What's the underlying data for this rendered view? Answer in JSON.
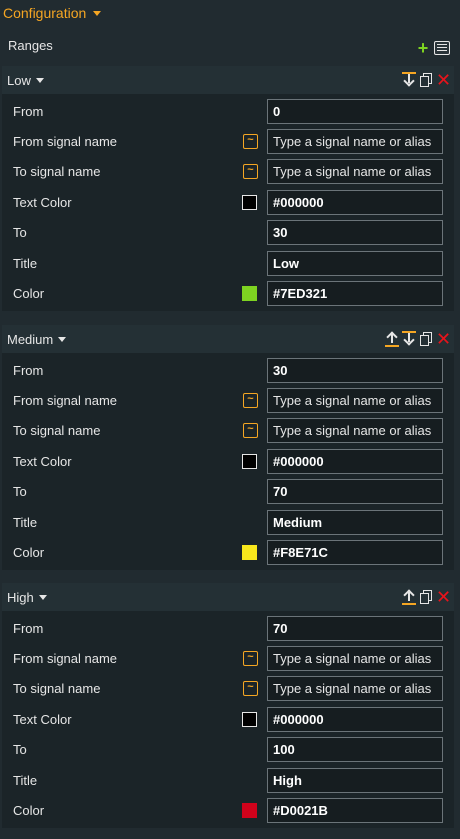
{
  "configuration": {
    "title": "Configuration"
  },
  "ranges": {
    "label": "Ranges",
    "add_icon": "plus-icon",
    "list_icon": "list-icon"
  },
  "labels": {
    "from": "From",
    "from_signal": "From signal name",
    "to_signal": "To signal name",
    "text_color": "Text Color",
    "to": "To",
    "title": "Title",
    "color": "Color"
  },
  "placeholder": "Type a signal name or alias",
  "range_items": [
    {
      "name": "Low",
      "from": "0",
      "text_color": "#000000",
      "to": "30",
      "title": "Low",
      "color": "#7ED321",
      "swatch": "#7ed321",
      "text_swatch": "#000000"
    },
    {
      "name": "Medium",
      "from": "30",
      "text_color": "#000000",
      "to": "70",
      "title": "Medium",
      "color": "#F8E71C",
      "swatch": "#f8e71c",
      "text_swatch": "#000000"
    },
    {
      "name": "High",
      "from": "70",
      "text_color": "#000000",
      "to": "100",
      "title": "High",
      "color": "#D0021B",
      "swatch": "#d0021b",
      "text_swatch": "#000000"
    }
  ],
  "colors": {
    "accent": "#f5a623",
    "add": "#7ed321",
    "delete": "#e8131b",
    "background": "#212b30"
  }
}
